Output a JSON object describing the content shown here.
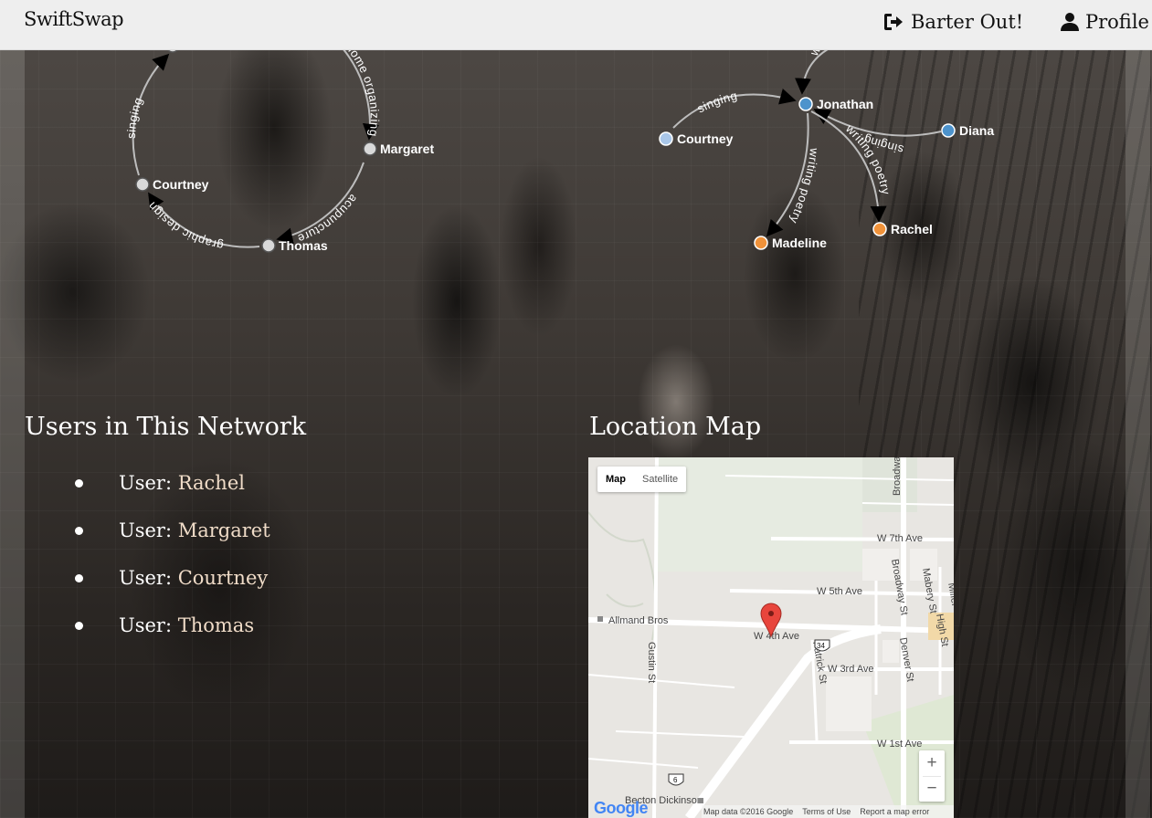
{
  "navbar": {
    "brand": "SwiftSwap",
    "barter_label": "Barter Out!",
    "profile_label": "Profile",
    "barter_icon": "sign-out-icon",
    "profile_icon": "user-icon"
  },
  "graph": {
    "left_cluster": {
      "nodes": [
        "Jonathan",
        "Margaret",
        "Courtney",
        "Thomas"
      ],
      "edges": [
        "home organizing",
        "acupuncture",
        "graphic design",
        "singing"
      ]
    },
    "right_cluster": {
      "nodes": [
        "Jonathan",
        "Courtney",
        "Diana",
        "Rachel",
        "Madeline"
      ],
      "edges": [
        "singing",
        "singing",
        "writing poetry",
        "writing poetry",
        "wr"
      ]
    },
    "colors": {
      "grey": "#d9d9d9",
      "light_blue": "#a9c6e8",
      "blue": "#4d93cc",
      "orange": "#f0923a",
      "edge": "#bdbdbd"
    }
  },
  "users_section": {
    "title": "Users in This Network",
    "prefix": "User:",
    "users": [
      "Rachel",
      "Margaret",
      "Courtney",
      "Thomas"
    ]
  },
  "map_section": {
    "title": "Location Map",
    "toggle": [
      "Map",
      "Satellite"
    ],
    "zoom_in": "+",
    "zoom_out": "−",
    "streets": [
      "W 7th Ave",
      "W 5th Ave",
      "W 4th Ave",
      "W 3rd Ave",
      "W 1st Ave",
      "Broadway",
      "Broadway St",
      "Mabery St",
      "High St",
      "Denver St",
      "Patrick St",
      "Gustin St",
      "Miller"
    ],
    "places": [
      "Allmand Bros",
      "Becton Dickinson"
    ],
    "shields": [
      "34",
      "6"
    ],
    "footer": [
      "Map data ©2016 Google",
      "Terms of Use",
      "Report a map error"
    ],
    "logo": "Google"
  }
}
